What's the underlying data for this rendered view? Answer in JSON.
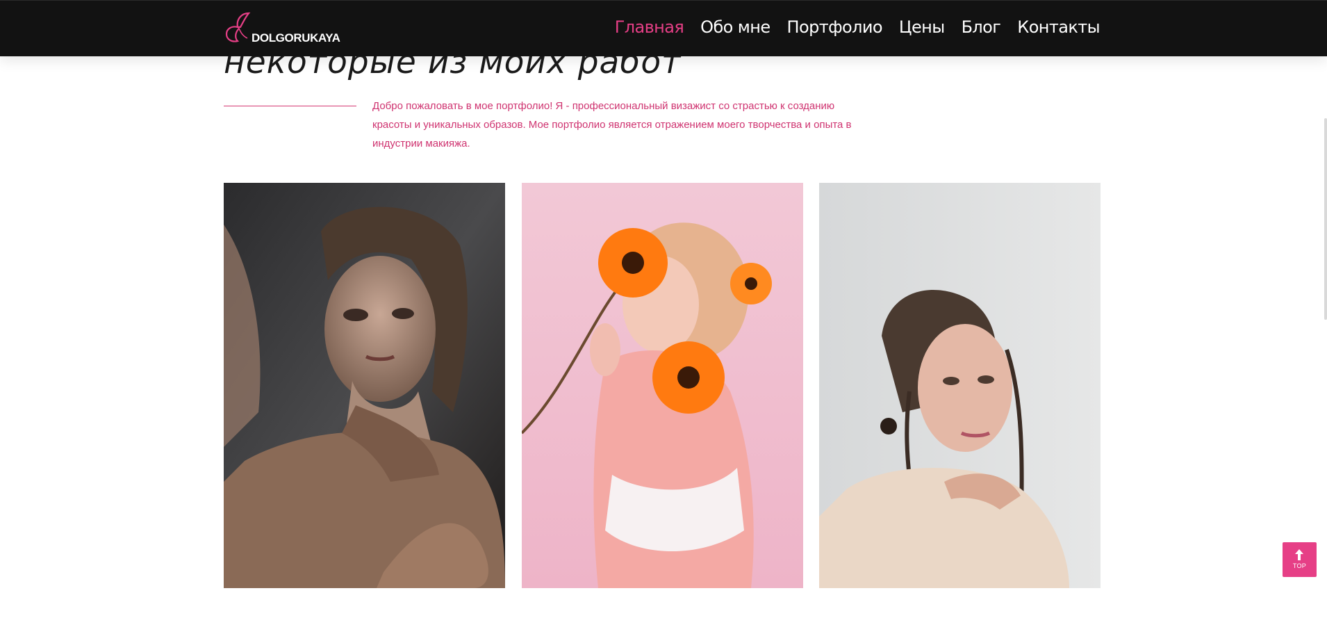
{
  "header": {
    "logo_text": "DOLGORUKAYA",
    "nav": [
      {
        "label": "Главная",
        "active": true
      },
      {
        "label": "Обо мне",
        "active": false
      },
      {
        "label": "Портфолио",
        "active": false
      },
      {
        "label": "Цены",
        "active": false
      },
      {
        "label": "Блог",
        "active": false
      },
      {
        "label": "Контакты",
        "active": false
      }
    ]
  },
  "section": {
    "title": "некоторые из моих работ",
    "intro_lines": [
      "Добро пожаловать в мое портфолио! Я - профессиональный визажист со страстью к созданию",
      "красоты и уникальных образов. Мое портфолио является отражением моего творчества и опыта в",
      "индустрии макияжа."
    ]
  },
  "gallery": [
    {
      "icon": "portrait-photo-dark-studio"
    },
    {
      "icon": "portrait-photo-orange-gerberas-pink"
    },
    {
      "icon": "portrait-photo-braids-light"
    }
  ],
  "scroll_top": {
    "label": "TOP",
    "icon": "arrow-up-icon"
  },
  "colors": {
    "accent": "#e63f86",
    "header_bg": "#121212",
    "text_pink": "#cf3370"
  }
}
